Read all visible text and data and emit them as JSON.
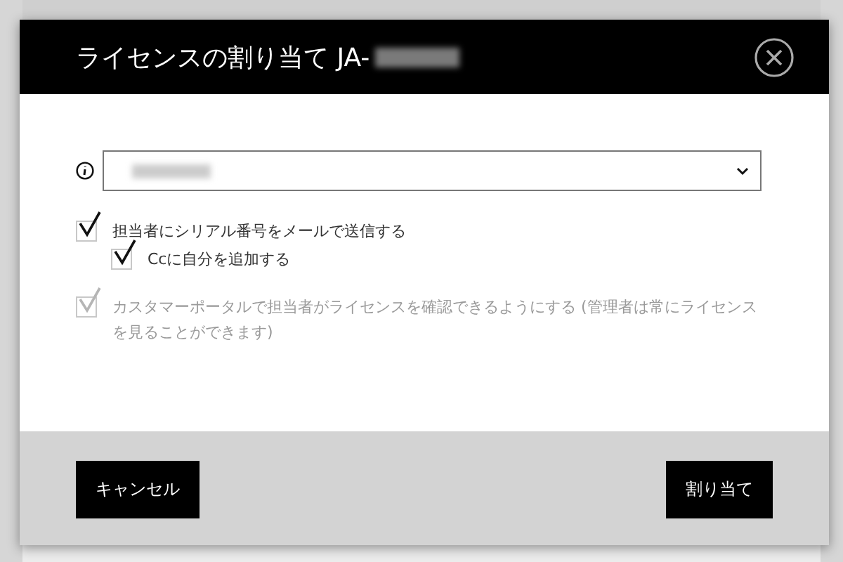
{
  "dialog": {
    "title": "ライセンスの割り当て JA-",
    "options": [
      {
        "label": "担当者にシリアル番号をメールで送信する",
        "checked": true,
        "disabled": false,
        "children": [
          {
            "label": "Ccに自分を追加する",
            "checked": true,
            "disabled": false
          }
        ]
      },
      {
        "label": "カスタマーポータルで担当者がライセンスを確認できるようにする (管理者は常にライセンスを見ることができます)",
        "checked": true,
        "disabled": true
      }
    ],
    "buttons": [
      {
        "label": "キャンセル"
      },
      {
        "label": "割り当て"
      }
    ]
  }
}
